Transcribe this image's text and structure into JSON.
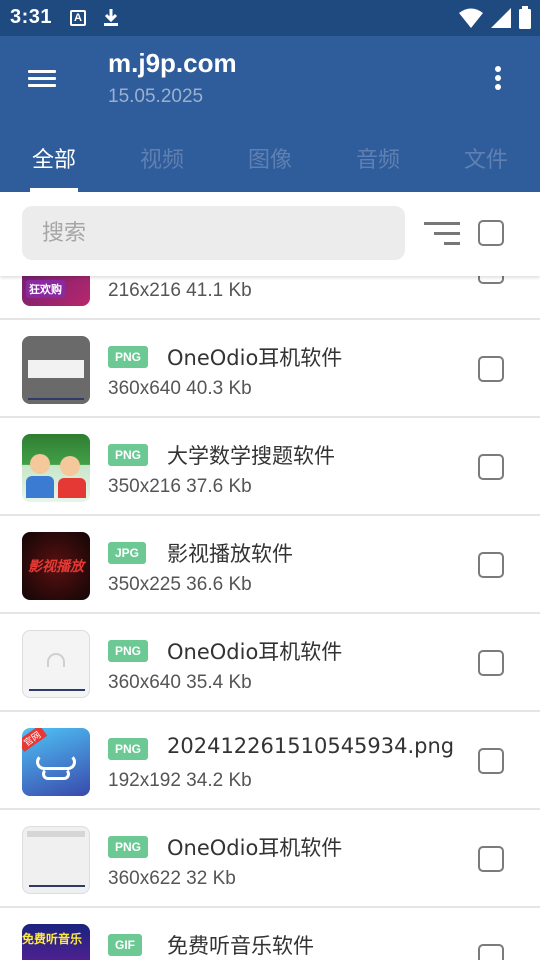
{
  "status": {
    "time": "3:31",
    "a_icon": "A"
  },
  "appbar": {
    "title": "m.j9p.com",
    "subtitle": "15.05.2025"
  },
  "tabs": [
    "全部",
    "视频",
    "图像",
    "音频",
    "文件"
  ],
  "search": {
    "placeholder": "搜索",
    "value": ""
  },
  "rows": [
    {
      "name": "",
      "type": "",
      "meta": "216x216 41.1 Kb",
      "thumb_text": "狂欢购"
    },
    {
      "name": "OneOdio耳机软件",
      "type": "PNG",
      "meta": "360x640 40.3 Kb"
    },
    {
      "name": "大学数学搜题软件",
      "type": "PNG",
      "meta": "350x216 37.6 Kb"
    },
    {
      "name": "影视播放软件",
      "type": "JPG",
      "meta": "350x225 36.6 Kb",
      "thumb_text": "影视播放"
    },
    {
      "name": "OneOdio耳机软件",
      "type": "PNG",
      "meta": "360x640 35.4 Kb"
    },
    {
      "name": "202412261510545934.png",
      "type": "PNG",
      "meta": "192x192 34.2 Kb",
      "thumb_text": "官网"
    },
    {
      "name": "OneOdio耳机软件",
      "type": "PNG",
      "meta": "360x622 32 Kb"
    },
    {
      "name": "免费听音乐软件",
      "type": "GIF",
      "meta": "",
      "thumb_text": "免费听音乐"
    }
  ],
  "colors": {
    "appbar": "#2f5d9b",
    "statusbar": "#1f4a80",
    "badge": "#6cc994"
  },
  "icons": {
    "menu": "menu-icon",
    "more": "more-vert-icon",
    "sort": "sort-icon",
    "download": "download-icon",
    "wifi": "wifi-icon",
    "signal": "signal-icon",
    "battery": "battery-icon"
  }
}
